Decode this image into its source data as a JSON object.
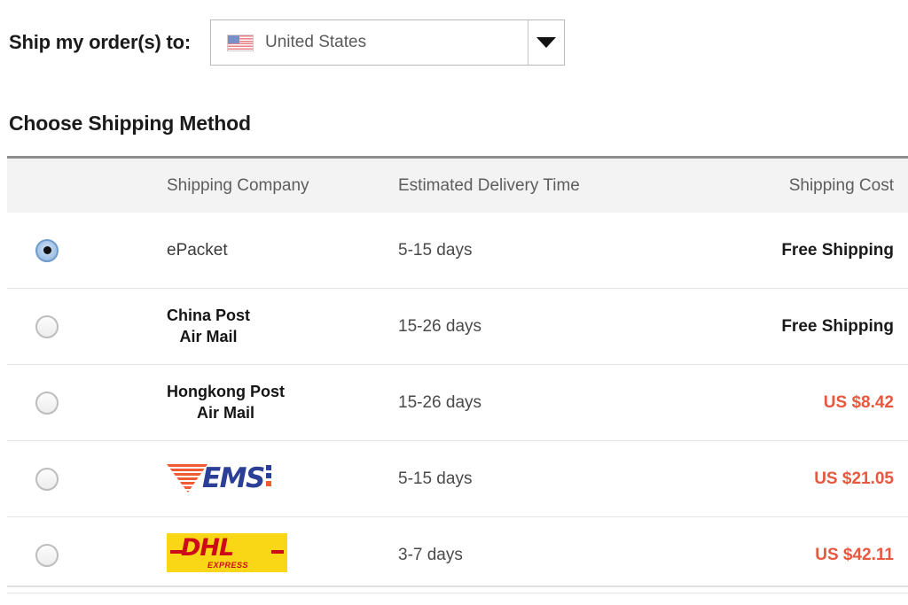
{
  "shipto": {
    "label": "Ship my order(s) to:",
    "country": "United States",
    "flag_icon": "us-flag-icon",
    "caret_icon": "chevron-down-icon"
  },
  "section": {
    "title": "Choose Shipping Method"
  },
  "table": {
    "columns": {
      "company": "Shipping Company",
      "time": "Estimated Delivery Time",
      "cost": "Shipping Cost"
    },
    "rows": [
      {
        "selected": true,
        "company_type": "text",
        "company": "ePacket",
        "company_line2": "",
        "time": "5-15 days",
        "cost": "Free Shipping",
        "cost_kind": "free"
      },
      {
        "selected": false,
        "company_type": "text-bold-two-line",
        "company": "China Post",
        "company_line2": "Air Mail",
        "time": "15-26 days",
        "cost": "Free Shipping",
        "cost_kind": "free"
      },
      {
        "selected": false,
        "company_type": "text-bold-two-line",
        "company": "Hongkong Post",
        "company_line2": "Air Mail",
        "time": "15-26 days",
        "cost": "US $8.42",
        "cost_kind": "paid"
      },
      {
        "selected": false,
        "company_type": "logo-ems",
        "company": "EMS",
        "company_line2": "",
        "time": "5-15 days",
        "cost": "US $21.05",
        "cost_kind": "paid"
      },
      {
        "selected": false,
        "company_type": "logo-dhl",
        "company": "DHL",
        "company_line2": "EXPRESS",
        "time": "3-7 days",
        "cost": "US $42.11",
        "cost_kind": "paid"
      }
    ]
  },
  "colors": {
    "price_red": "#e8573f",
    "dhl_yellow": "#f9d616",
    "dhl_red": "#cc0a19",
    "ems_blue": "#2b3f96",
    "ems_orange": "#ef5b33",
    "radio_selected_blue": "#6f9ccd"
  }
}
